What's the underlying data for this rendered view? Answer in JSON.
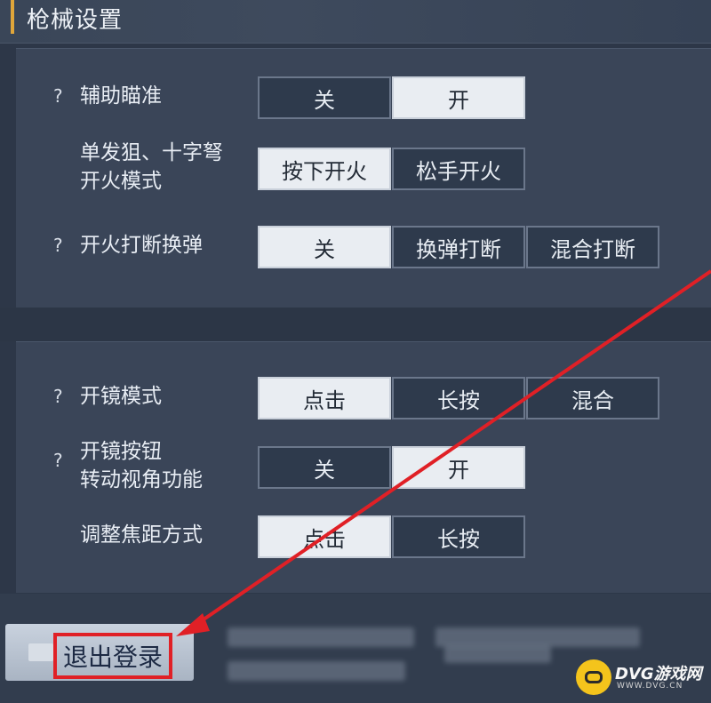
{
  "header": {
    "title": "枪械设置"
  },
  "settings": [
    {
      "help": "?",
      "label_lines": [
        "辅助瞄准"
      ],
      "options": [
        "关",
        "开"
      ],
      "selected": 1
    },
    {
      "help": "",
      "label_lines": [
        "单发狙、十字弩",
        "开火模式"
      ],
      "options": [
        "按下开火",
        "松手开火"
      ],
      "selected": 0
    },
    {
      "help": "?",
      "label_lines": [
        "开火打断换弹"
      ],
      "options": [
        "关",
        "换弹打断",
        "混合打断"
      ],
      "selected": 0
    },
    {
      "help": "?",
      "label_lines": [
        "开镜模式"
      ],
      "options": [
        "点击",
        "长按",
        "混合"
      ],
      "selected": 0
    },
    {
      "help": "?",
      "label_lines": [
        "开镜按钮",
        "转动视角功能"
      ],
      "options": [
        "关",
        "开"
      ],
      "selected": 1
    },
    {
      "help": "",
      "label_lines": [
        "调整焦距方式"
      ],
      "options": [
        "点击",
        "长按"
      ],
      "selected": 0
    }
  ],
  "footer": {
    "logout_label": "退出登录"
  },
  "watermark": {
    "text": "DVG游戏网",
    "sub": "WWW.DVG.CN"
  },
  "colors": {
    "annotation_red": "#e02026",
    "selected_bg": "#e9edf2",
    "accent": "#e0a63a"
  }
}
